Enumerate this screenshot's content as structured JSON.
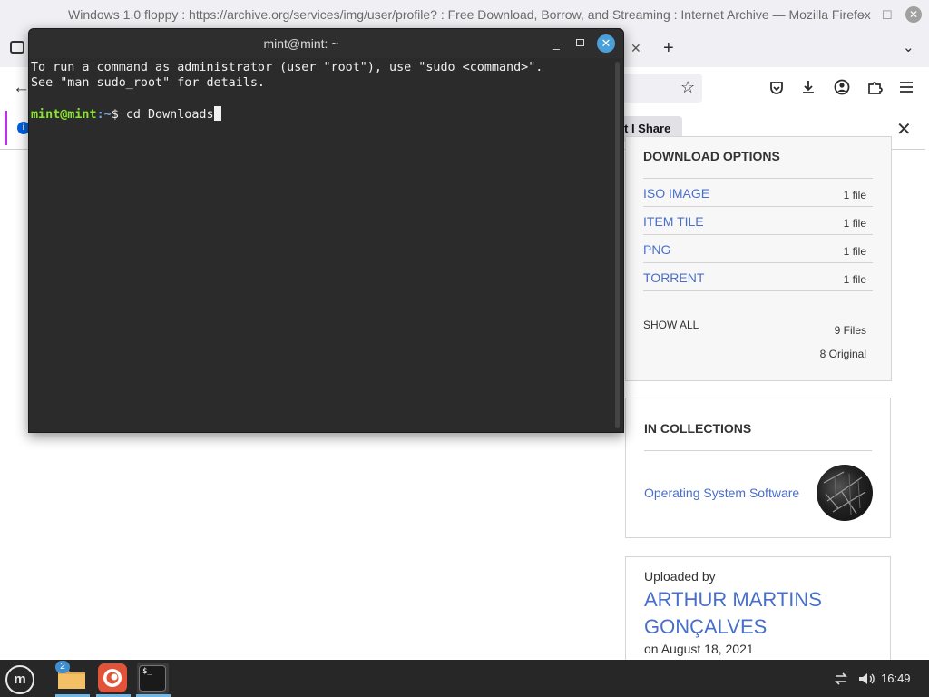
{
  "browser": {
    "title": "Windows 1.0 floppy : https://archive.org/services/img/user/profile? : Free Download, Borrow, and Streaming : Internet Archive — Mozilla Firefox",
    "share_label": "t I Share",
    "window_controls": {
      "minimize": "–",
      "maximize": "☐",
      "close": "✕"
    }
  },
  "download_options": {
    "title": "DOWNLOAD OPTIONS",
    "items": [
      {
        "label": "ISO IMAGE",
        "count": "1 file"
      },
      {
        "label": "ITEM TILE",
        "count": "1 file"
      },
      {
        "label": "PNG",
        "count": "1 file"
      },
      {
        "label": "TORRENT",
        "count": "1 file"
      }
    ],
    "show_all": "SHOW ALL",
    "files_total": "9 Files",
    "original_total": "8 Original"
  },
  "collections": {
    "title": "IN COLLECTIONS",
    "item": "Operating System Software"
  },
  "uploader": {
    "label": "Uploaded by",
    "name_line1": "ARTHUR MARTINS",
    "name_line2": "GONÇALVES",
    "date": "on August 18, 2021"
  },
  "terminal": {
    "title": "mint@mint: ~",
    "line1": "To run a command as administrator (user \"root\"), use \"sudo <command>\".",
    "line2": "See \"man sudo_root\" for details.",
    "prompt_user": "mint@mint",
    "prompt_path": ":~",
    "prompt_symbol": "$ ",
    "command": "cd Downloads"
  },
  "taskbar": {
    "files_badge": "2",
    "clock": "16:49",
    "term_icon_text": "$_"
  },
  "colors": {
    "link": "#4a6fc9",
    "prompt_green": "#8ae234",
    "taskbar": "#272727"
  }
}
